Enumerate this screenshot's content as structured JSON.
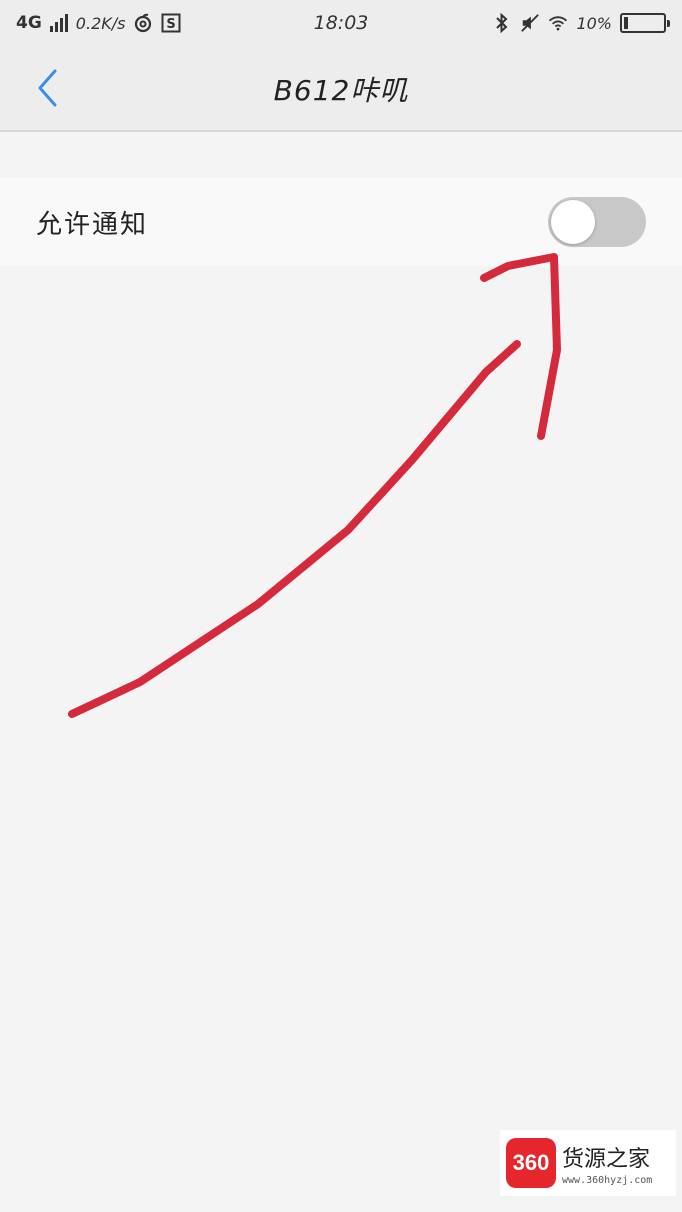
{
  "status_bar": {
    "network": "4G",
    "speed": "0.2K/s",
    "time": "18:03",
    "battery_percent": "10%",
    "battery_level": 0.1,
    "icons": [
      "signal-icon",
      "netease-music-icon",
      "s-app-icon",
      "bluetooth-icon",
      "vibrate-off-icon",
      "wifi-icon",
      "battery-icon"
    ]
  },
  "header": {
    "title": "B612咔叽",
    "back_icon": "chevron-left-icon"
  },
  "settings": {
    "allow_notifications_label": "允许通知",
    "allow_notifications_on": false
  },
  "colors": {
    "accent": "#3a8ee6",
    "toggle_off": "#c8c8c8",
    "annotation": "#d42a3c",
    "background": "#f4f4f4"
  },
  "watermark": {
    "logo_text": "360",
    "name": "货源之家",
    "url": "www.360hyzj.com"
  }
}
